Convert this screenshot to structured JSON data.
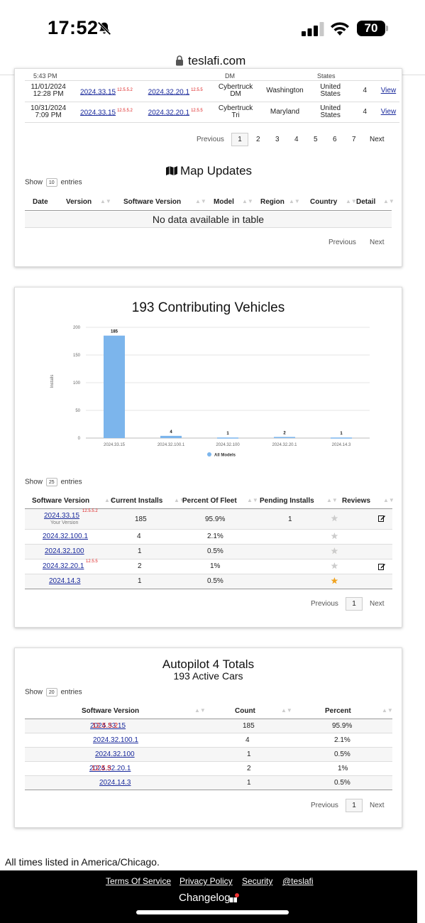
{
  "status_bar": {
    "time": "17:52",
    "battery": "70"
  },
  "browser": {
    "url": "teslafi.com"
  },
  "recent_installs": {
    "partial_row": {
      "time": "5:43 PM",
      "model": "DM",
      "country": "States"
    },
    "rows": [
      {
        "date": "11/01/2024",
        "time": "12:28 PM",
        "version": "2024.33.15",
        "version_tag": "12.5.5.2",
        "software": "2024.32.20.1",
        "software_tag": "12.5.5",
        "model_line1": "Cybertruck",
        "model_line2": "DM",
        "region": "Washington",
        "country_line1": "United",
        "country_line2": "States",
        "count": "4",
        "detail": "View"
      },
      {
        "date": "10/31/2024",
        "time": "7:09 PM",
        "version": "2024.33.15",
        "version_tag": "12.5.5.2",
        "software": "2024.32.20.1",
        "software_tag": "12.5.5",
        "model_line1": "Cybertruck",
        "model_line2": "Tri",
        "region": "Maryland",
        "country_line1": "United",
        "country_line2": "States",
        "count": "4",
        "detail": "View"
      }
    ],
    "pager": {
      "previous": "Previous",
      "pages": [
        "1",
        "2",
        "3",
        "4",
        "5",
        "6",
        "7"
      ],
      "next": "Next"
    }
  },
  "map_updates": {
    "title": "Map Updates",
    "show": "Show",
    "entries_value": "10",
    "entries": "entries",
    "columns": [
      "Date",
      "Version",
      "Software Version",
      "Model",
      "Region",
      "Country",
      "Detail"
    ],
    "empty": "No data available in table",
    "pager": {
      "previous": "Previous",
      "next": "Next"
    }
  },
  "contributing": {
    "title": "193 Contributing Vehicles",
    "show": "Show",
    "entries_value": "25",
    "entries": "entries",
    "columns": [
      "Software Version",
      "Current Installs",
      "Percent Of Fleet",
      "Pending Installs",
      "Reviews"
    ],
    "rows": [
      {
        "version": "2024.33.15",
        "tag": "12.5.5.2",
        "sub": "Your Version",
        "installs": "185",
        "percent": "95.9%",
        "pending": "1",
        "stars": 0,
        "edit": true
      },
      {
        "version": "2024.32.100.1",
        "tag": "",
        "sub": "",
        "installs": "4",
        "percent": "2.1%",
        "pending": "",
        "stars": 0,
        "edit": false
      },
      {
        "version": "2024.32.100",
        "tag": "",
        "sub": "",
        "installs": "1",
        "percent": "0.5%",
        "pending": "",
        "stars": 1,
        "edit": false
      },
      {
        "version": "2024.32.20.1",
        "tag": "12.5.5",
        "sub": "",
        "installs": "2",
        "percent": "1%",
        "pending": "",
        "stars": 0,
        "edit": true
      },
      {
        "version": "2024.14.3",
        "tag": "",
        "sub": "",
        "installs": "1",
        "percent": "0.5%",
        "pending": "",
        "stars": 5,
        "edit": false
      }
    ],
    "pager": {
      "previous": "Previous",
      "page": "1",
      "next": "Next"
    }
  },
  "chart_data": {
    "type": "bar",
    "categories": [
      "2024.33.15",
      "2024.32.100.1",
      "2024.32.100",
      "2024.32.20.1",
      "2024.14.3"
    ],
    "series": [
      {
        "name": "All Models",
        "values": [
          185,
          4,
          1,
          2,
          1
        ]
      }
    ],
    "ylabel": "Installs",
    "ylim": [
      0,
      200
    ],
    "yticks": [
      0,
      50,
      100,
      150,
      200
    ],
    "grid": true,
    "legend": "bottom",
    "color": "#7cb5ec"
  },
  "autopilot": {
    "title": "Autopilot 4 Totals",
    "subtitle": "193 Active Cars",
    "show": "Show",
    "entries_value": "20",
    "entries": "entries",
    "columns": [
      "Software Version",
      "Count",
      "Percent"
    ],
    "rows": [
      {
        "version": "2024.33.15",
        "tag": "12.5.5.2",
        "count": "185",
        "percent": "95.9%"
      },
      {
        "version": "2024.32.100.1",
        "tag": "",
        "count": "4",
        "percent": "2.1%"
      },
      {
        "version": "2024.32.100",
        "tag": "",
        "count": "1",
        "percent": "0.5%"
      },
      {
        "version": "2024.32.20.1",
        "tag": "12.5.5",
        "count": "2",
        "percent": "1%"
      },
      {
        "version": "2024.14.3",
        "tag": "",
        "count": "1",
        "percent": "0.5%"
      }
    ],
    "pager": {
      "previous": "Previous",
      "page": "1",
      "next": "Next"
    }
  },
  "footnote": "All times listed in America/Chicago.",
  "footer": {
    "links": [
      "Terms Of Service",
      "Privacy Policy",
      "Security",
      "@teslafi"
    ],
    "changelog": "Changelog"
  }
}
